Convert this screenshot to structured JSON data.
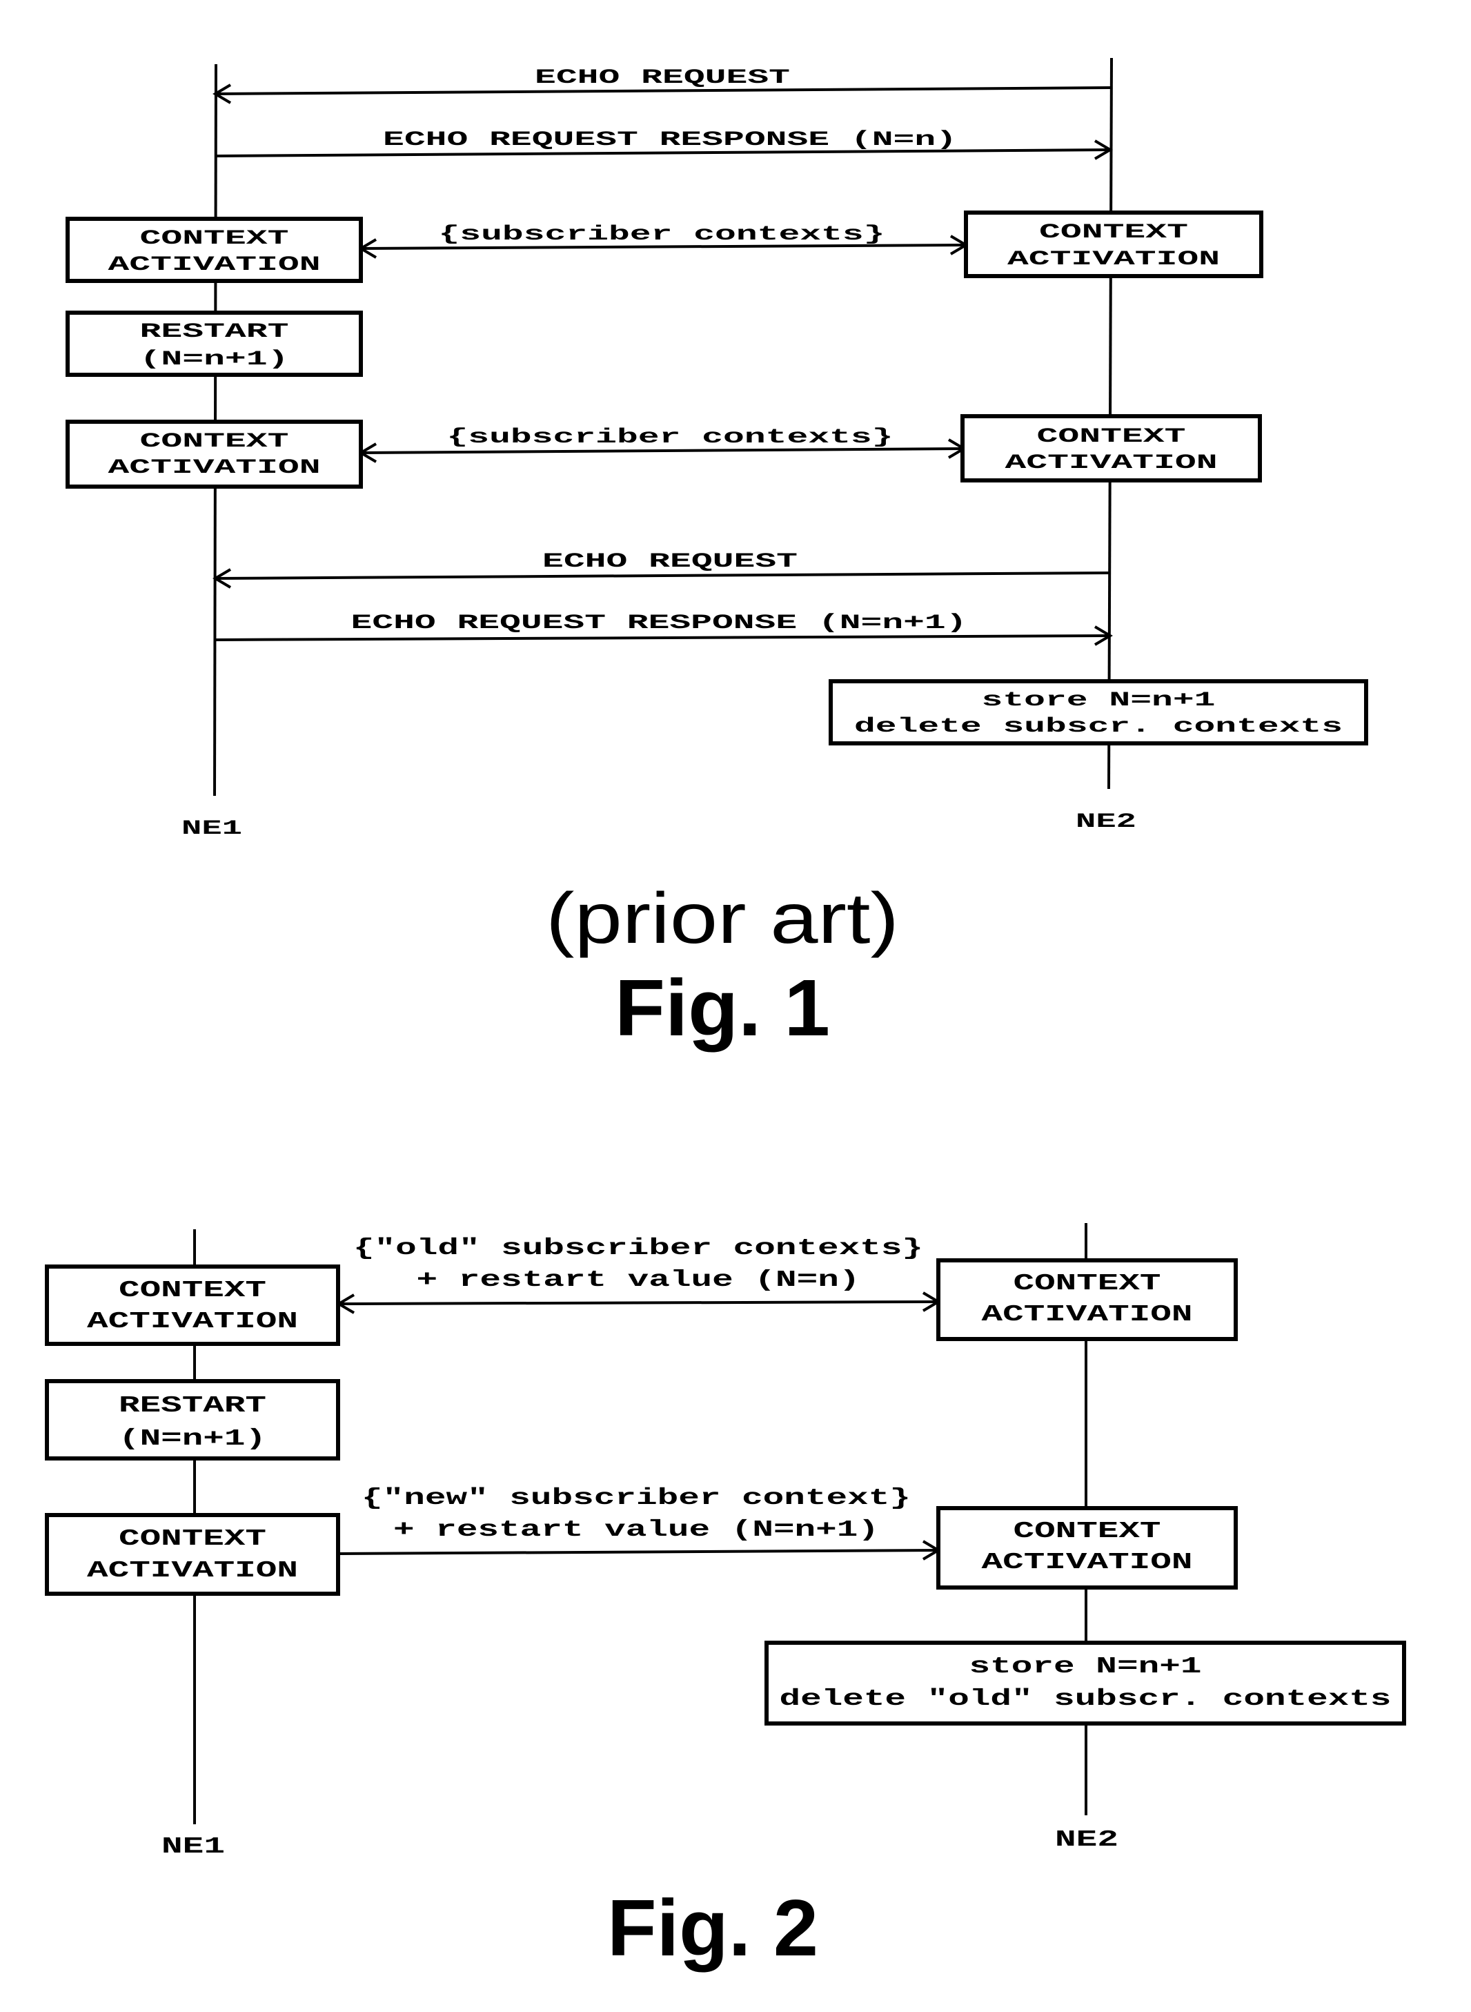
{
  "figures": [
    {
      "id": "fig1",
      "caption_note": "(prior art)",
      "caption": "Fig. 1",
      "participants": {
        "left": "NE1",
        "right": "NE2"
      },
      "messages": [
        {
          "label": [
            "ECHO REQUEST"
          ],
          "direction": "to-left"
        },
        {
          "label": [
            "ECHO REQUEST RESPONSE (N=n)"
          ],
          "direction": "to-right"
        },
        {
          "label": [
            "{subscriber contexts}"
          ],
          "direction": "both"
        },
        {
          "label": [
            "{subscriber contexts}"
          ],
          "direction": "both"
        },
        {
          "label": [
            "ECHO REQUEST"
          ],
          "direction": "to-left"
        },
        {
          "label": [
            "ECHO REQUEST RESPONSE (N=n+1)"
          ],
          "direction": "to-right"
        }
      ],
      "boxes": [
        {
          "side": "left",
          "lines": [
            "CONTEXT",
            "ACTIVATION"
          ]
        },
        {
          "side": "left",
          "lines": [
            "RESTART",
            "(N=n+1)"
          ]
        },
        {
          "side": "left",
          "lines": [
            "CONTEXT",
            "ACTIVATION"
          ]
        },
        {
          "side": "right",
          "lines": [
            "CONTEXT",
            "ACTIVATION"
          ]
        },
        {
          "side": "right",
          "lines": [
            "CONTEXT",
            "ACTIVATION"
          ]
        },
        {
          "side": "right",
          "lines": [
            "store N=n+1",
            "delete subscr. contexts"
          ]
        }
      ]
    },
    {
      "id": "fig2",
      "caption": "Fig. 2",
      "participants": {
        "left": "NE1",
        "right": "NE2"
      },
      "messages": [
        {
          "label": [
            "{\"old\" subscriber contexts}",
            "+ restart value (N=n)"
          ],
          "direction": "both"
        },
        {
          "label": [
            "{\"new\" subscriber context}",
            "+ restart value (N=n+1)"
          ],
          "direction": "to-right"
        }
      ],
      "boxes": [
        {
          "side": "left",
          "lines": [
            "CONTEXT",
            "ACTIVATION"
          ]
        },
        {
          "side": "left",
          "lines": [
            "RESTART",
            "(N=n+1)"
          ]
        },
        {
          "side": "left",
          "lines": [
            "CONTEXT",
            "ACTIVATION"
          ]
        },
        {
          "side": "right",
          "lines": [
            "CONTEXT",
            "ACTIVATION"
          ]
        },
        {
          "side": "right",
          "lines": [
            "CONTEXT",
            "ACTIVATION"
          ]
        },
        {
          "side": "right",
          "lines": [
            "store N=n+1",
            "delete \"old\" subscr. contexts"
          ]
        }
      ]
    }
  ]
}
